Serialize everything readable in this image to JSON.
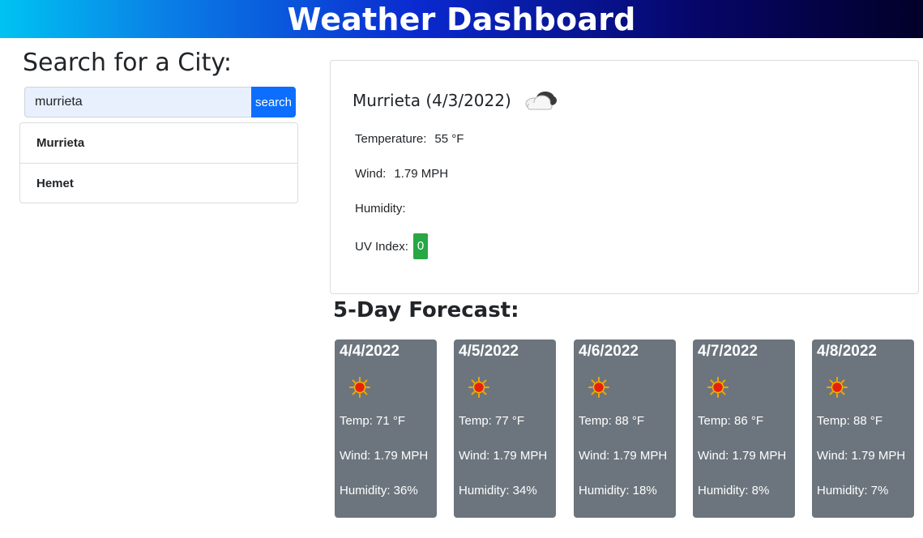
{
  "header": {
    "title": "Weather Dashboard"
  },
  "search": {
    "title": "Search for a City:",
    "input_value": "murrieta",
    "button_label": "search"
  },
  "history": [
    "Murrieta",
    "Hemet"
  ],
  "current": {
    "title": "Murrieta (4/3/2022)",
    "icon": "cloud-icon",
    "temperature_label": "Temperature:",
    "temperature_value": "55 °F",
    "wind_label": "Wind:",
    "wind_value": "1.79 MPH",
    "humidity_label": "Humidity:",
    "humidity_value": "",
    "uv_label": "UV Index:",
    "uv_value": "0",
    "uv_color": "#28a745"
  },
  "forecast": {
    "title": "5-Day Forecast:",
    "days": [
      {
        "date": "4/4/2022",
        "icon": "sun-icon",
        "temp": "Temp: 71 °F",
        "wind": "Wind: 1.79 MPH",
        "humidity": "Humidity: 36%"
      },
      {
        "date": "4/5/2022",
        "icon": "sun-icon",
        "temp": "Temp: 77 °F",
        "wind": "Wind: 1.79 MPH",
        "humidity": "Humidity: 34%"
      },
      {
        "date": "4/6/2022",
        "icon": "sun-icon",
        "temp": "Temp: 88 °F",
        "wind": "Wind: 1.79 MPH",
        "humidity": "Humidity: 18%"
      },
      {
        "date": "4/7/2022",
        "icon": "sun-icon",
        "temp": "Temp: 86 °F",
        "wind": "Wind: 1.79 MPH",
        "humidity": "Humidity: 8%"
      },
      {
        "date": "4/8/2022",
        "icon": "sun-icon",
        "temp": "Temp: 88 °F",
        "wind": "Wind: 1.79 MPH",
        "humidity": "Humidity: 7%"
      }
    ]
  },
  "colors": {
    "accent": "#0d6efd",
    "forecast_card": "#6c757d"
  }
}
